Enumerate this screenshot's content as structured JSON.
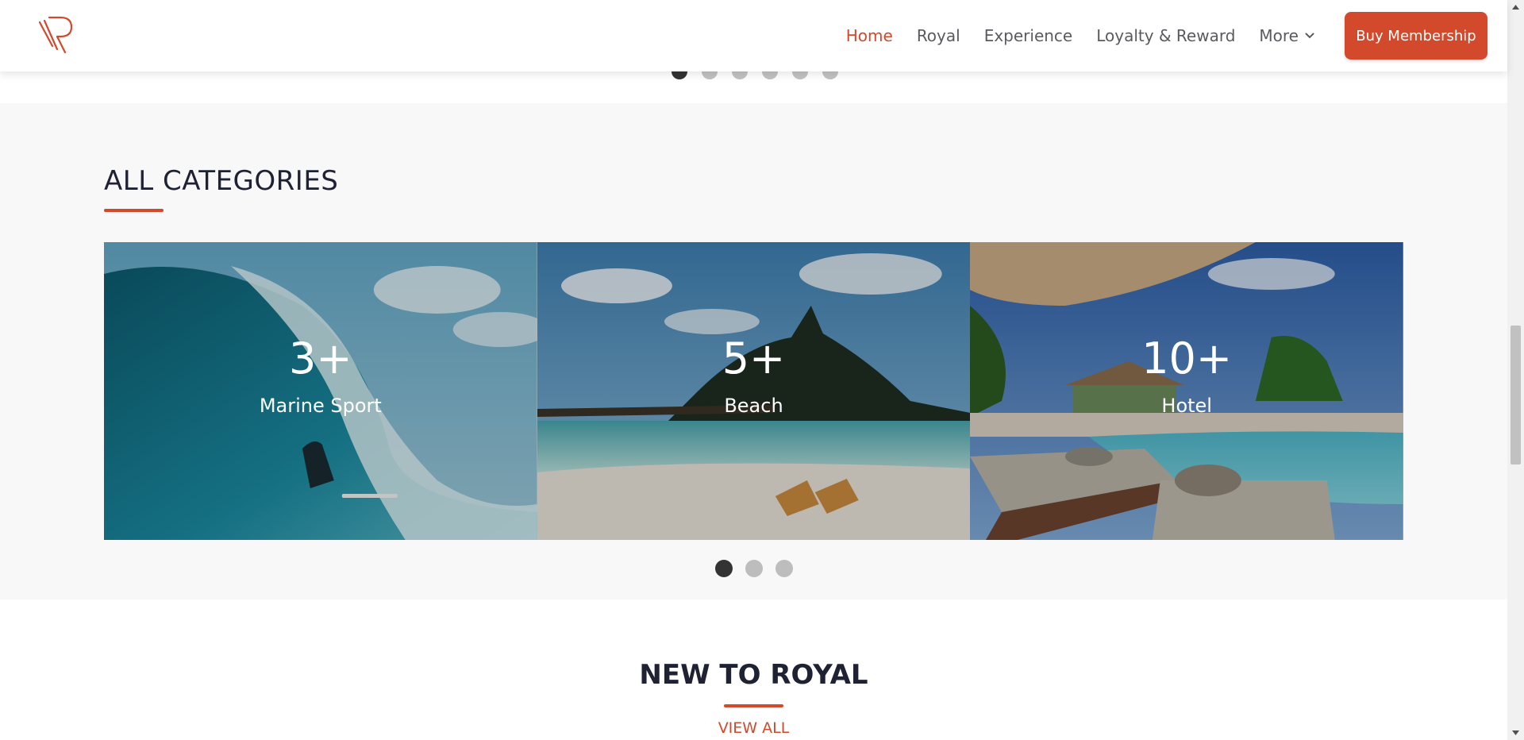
{
  "header": {
    "nav": [
      {
        "label": "Home",
        "active": true
      },
      {
        "label": "Royal"
      },
      {
        "label": "Experience"
      },
      {
        "label": "Loyalty & Reward"
      },
      {
        "label": "More",
        "has_dropdown": true
      }
    ],
    "cta_label": "Buy Membership"
  },
  "colors": {
    "accent": "#d2492b",
    "title": "#1e2233",
    "section_bg": "#f8f8f8"
  },
  "top_carousel": {
    "dots": 6,
    "active": 0
  },
  "categories": {
    "title": "ALL CATEGORIES",
    "cards": [
      {
        "count": "3+",
        "label": "Marine Sport",
        "image": "surfer-wave"
      },
      {
        "count": "5+",
        "label": "Beach",
        "image": "beach-island"
      },
      {
        "count": "10+",
        "label": "Hotel",
        "image": "hotel-pool"
      }
    ],
    "dots": 3,
    "active_dot": 0
  },
  "new_to_royal": {
    "title": "NEW TO ROYAL",
    "link": "VIEW ALL"
  }
}
